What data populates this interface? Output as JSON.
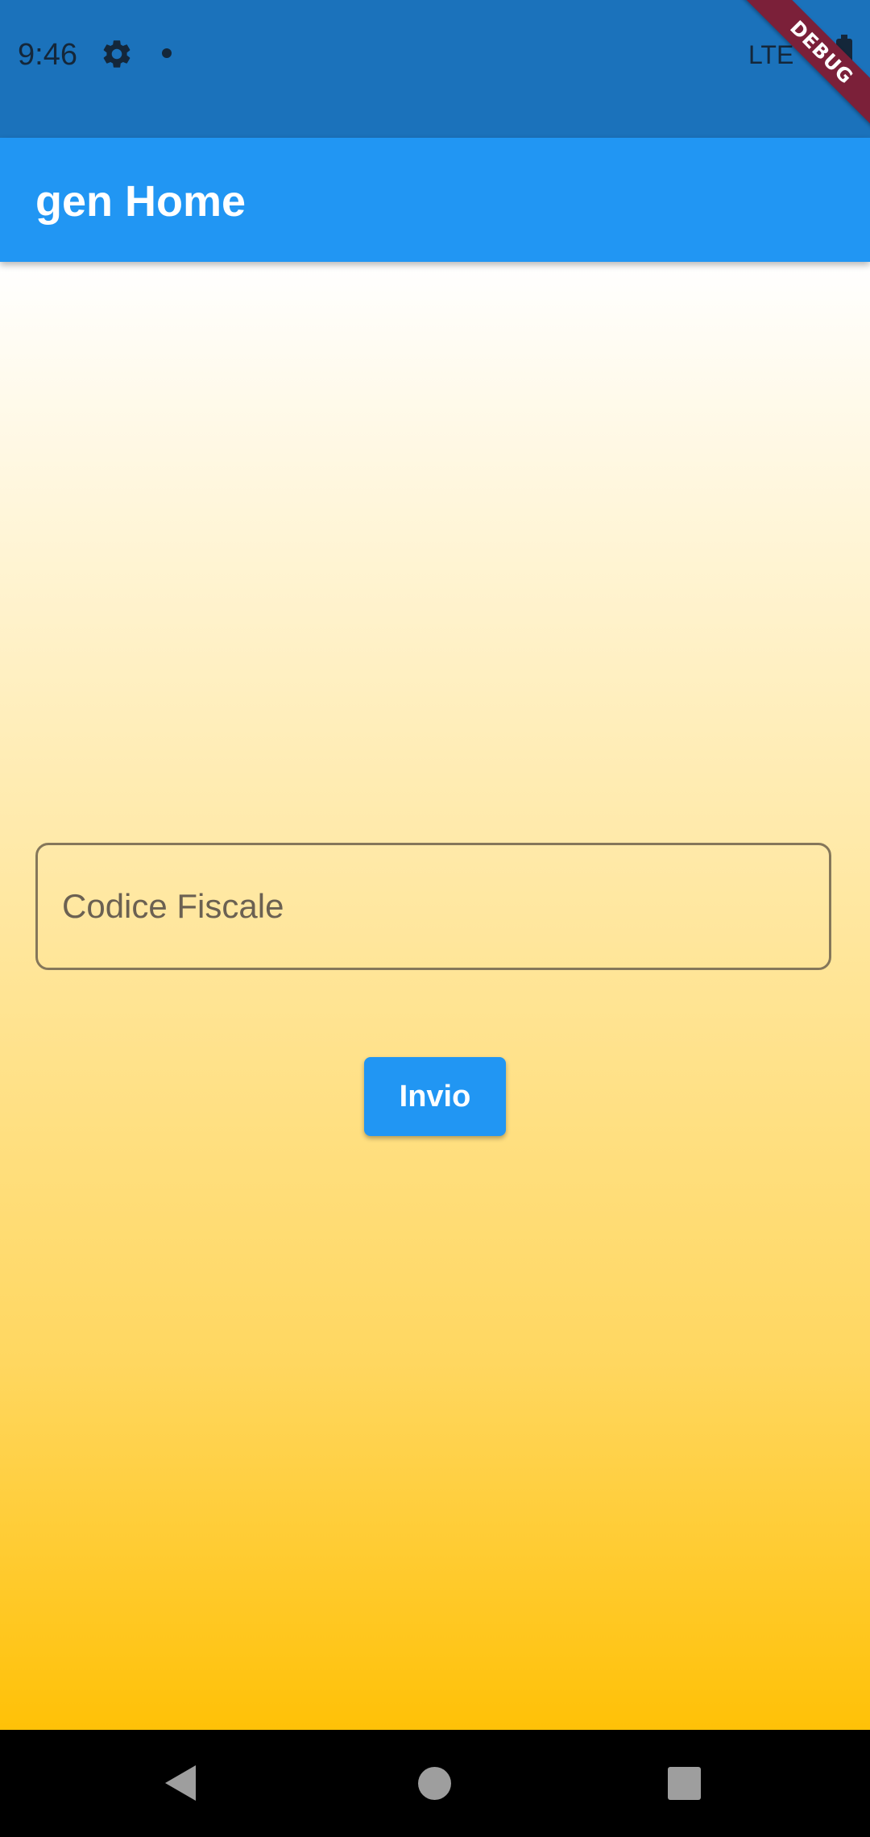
{
  "status_bar": {
    "time": "9:46",
    "network": "LTE",
    "icons": [
      "settings-icon",
      "notification-dot-icon",
      "battery-icon"
    ]
  },
  "debug_banner": {
    "label": "DEBUG"
  },
  "app_bar": {
    "title": "gen Home"
  },
  "form": {
    "codice_fiscale": {
      "value": "",
      "placeholder": "Codice Fiscale"
    },
    "submit_label": "Invio"
  },
  "nav_bar": {
    "icons": [
      "back-icon",
      "home-icon",
      "recents-icon"
    ]
  },
  "colors": {
    "status_bar": "#1b72bb",
    "app_bar": "#2196f3",
    "button": "#2196f3",
    "gradient_top": "#ffffff",
    "gradient_bottom": "#ffc107",
    "debug_banner": "#7b2039"
  }
}
